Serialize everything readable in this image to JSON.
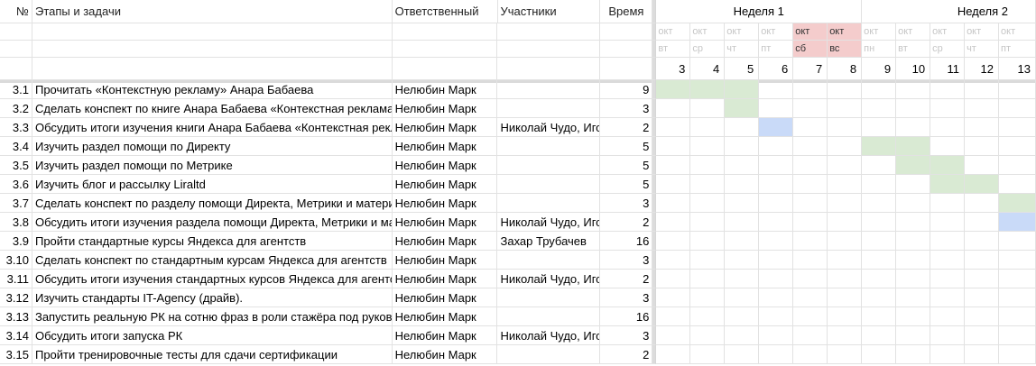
{
  "headers": {
    "num": "№",
    "task": "Этапы и задачи",
    "responsible": "Ответственный",
    "participants": "Участники",
    "time": "Время"
  },
  "weeks": [
    "Неделя 1",
    "Неделя 2"
  ],
  "days": [
    {
      "month": "окт",
      "dow": "вт",
      "num": "3",
      "weekend": false
    },
    {
      "month": "окт",
      "dow": "ср",
      "num": "4",
      "weekend": false
    },
    {
      "month": "окт",
      "dow": "чт",
      "num": "5",
      "weekend": false
    },
    {
      "month": "окт",
      "dow": "пт",
      "num": "6",
      "weekend": false
    },
    {
      "month": "окт",
      "dow": "сб",
      "num": "7",
      "weekend": true
    },
    {
      "month": "окт",
      "dow": "вс",
      "num": "8",
      "weekend": true
    },
    {
      "month": "окт",
      "dow": "пн",
      "num": "9",
      "weekend": false
    },
    {
      "month": "окт",
      "dow": "вт",
      "num": "10",
      "weekend": false
    },
    {
      "month": "окт",
      "dow": "ср",
      "num": "11",
      "weekend": false
    },
    {
      "month": "окт",
      "dow": "чт",
      "num": "12",
      "weekend": false
    },
    {
      "month": "окт",
      "dow": "пт",
      "num": "13",
      "weekend": false
    }
  ],
  "rows": [
    {
      "num": "3.1",
      "task": "Прочитать «Контекстную рекламу» Анара Бабаева",
      "responsible": "Нелюбин Марк",
      "participants": "",
      "time": "9",
      "bar": [
        0,
        3
      ],
      "color": "green"
    },
    {
      "num": "3.2",
      "task": "Сделать конспект по книге Анара Бабаева «Контекстная реклама»",
      "responsible": "Нелюбин Марк",
      "participants": "",
      "time": "3",
      "bar": [
        2,
        1
      ],
      "color": "green"
    },
    {
      "num": "3.3",
      "task": "Обсудить итоги изучения книги Анара Бабаева «Контекстная реклама»",
      "responsible": "Нелюбин Марк",
      "participants": "Николай Чудо, Игорь",
      "time": "2",
      "bar": [
        3,
        1
      ],
      "color": "blue"
    },
    {
      "num": "3.4",
      "task": "Изучить раздел помощи по Директу",
      "responsible": "Нелюбин Марк",
      "participants": "",
      "time": "5",
      "bar": [
        6,
        2
      ],
      "color": "green"
    },
    {
      "num": "3.5",
      "task": "Изучить раздел помощи по Метрике",
      "responsible": "Нелюбин Марк",
      "participants": "",
      "time": "5",
      "bar": [
        7,
        2
      ],
      "color": "green"
    },
    {
      "num": "3.6",
      "task": "Изучить блог и рассылку Liraltd",
      "responsible": "Нелюбин Марк",
      "participants": "",
      "time": "5",
      "bar": [
        8,
        2
      ],
      "color": "green"
    },
    {
      "num": "3.7",
      "task": "Сделать конспект по разделу помощи Директа, Метрики и материалам",
      "responsible": "Нелюбин Марк",
      "participants": "",
      "time": "3",
      "bar": [
        10,
        1
      ],
      "color": "green"
    },
    {
      "num": "3.8",
      "task": "Обсудить итоги изучения раздела помощи Директа, Метрики и материалов",
      "responsible": "Нелюбин Марк",
      "participants": "Николай Чудо, Игорь",
      "time": "2",
      "bar": [
        10,
        1
      ],
      "color": "blue"
    },
    {
      "num": "3.9",
      "task": "Пройти стандартные курсы Яндекса для агентств",
      "responsible": "Нелюбин Марк",
      "participants": "Захар Трубачев",
      "time": "16",
      "bar": null,
      "color": ""
    },
    {
      "num": "3.10",
      "task": "Сделать конспект по стандартным курсам Яндекса для агентств",
      "responsible": "Нелюбин Марк",
      "participants": "",
      "time": "3",
      "bar": null,
      "color": ""
    },
    {
      "num": "3.11",
      "task": "Обсудить итоги изучения стандартных курсов Яндекса для агентств",
      "responsible": "Нелюбин Марк",
      "participants": "Николай Чудо, Игорь",
      "time": "2",
      "bar": null,
      "color": ""
    },
    {
      "num": "3.12",
      "task": "Изучить стандарты IT-Agency (драйв).",
      "responsible": "Нелюбин Марк",
      "participants": "",
      "time": "3",
      "bar": null,
      "color": ""
    },
    {
      "num": "3.13",
      "task": "Запустить реальную РК на сотню фраз в роли стажёра под руководством",
      "responsible": "Нелюбин Марк",
      "participants": "",
      "time": "16",
      "bar": null,
      "color": ""
    },
    {
      "num": "3.14",
      "task": "Обсудить итоги запуска РК",
      "responsible": "Нелюбин Марк",
      "participants": "Николай Чудо, Игорь",
      "time": "3",
      "bar": null,
      "color": ""
    },
    {
      "num": "3.15",
      "task": "Пройти тренировочные тесты для сдачи сертификации",
      "responsible": "Нелюбин Марк",
      "participants": "",
      "time": "2",
      "bar": null,
      "color": ""
    }
  ],
  "colors": {
    "bar_green": "#d9ead3",
    "bar_blue": "#c9daf8",
    "weekend": "#f4cccc",
    "grid": "#e2e2e2"
  }
}
